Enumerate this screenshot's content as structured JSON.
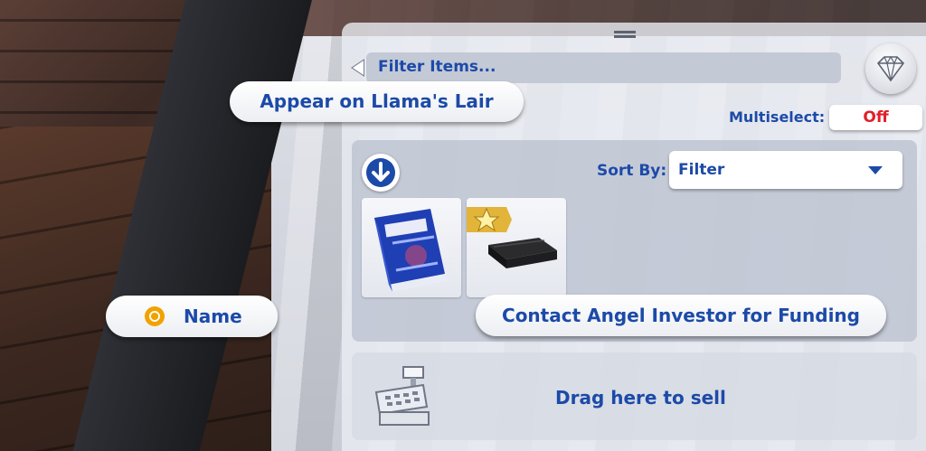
{
  "filter": {
    "label": "Filter Items..."
  },
  "buttons": {
    "appear_label": "Appear on Llama's Lair",
    "contact_label": "Contact Angel Investor for Funding",
    "name_label": "Name"
  },
  "multiselect": {
    "label": "Multiselect:",
    "value": "Off"
  },
  "sort": {
    "label": "Sort By:",
    "value": "Filter"
  },
  "items": [
    {
      "icon": "blue-book-item-icon"
    },
    {
      "icon": "black-device-item-icon",
      "badge": "star-badge-icon"
    }
  ],
  "sell": {
    "label": "Drag here to sell",
    "icon": "cash-register-icon"
  },
  "colors": {
    "accent": "#1c4aa8",
    "off": "#e0202a",
    "highlight": "#f2a200"
  }
}
